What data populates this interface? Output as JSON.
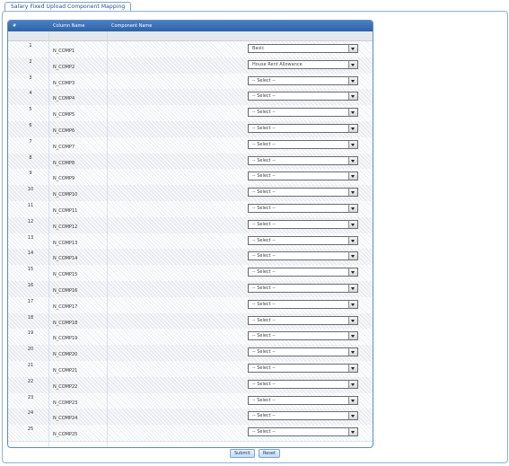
{
  "panel": {
    "title": "Salary Fixed Upload Component Mapping"
  },
  "table": {
    "headers": {
      "num": "#",
      "column": "Column Name",
      "component": "Component Name"
    },
    "rows": [
      {
        "num": "1",
        "column": "N_COMP1",
        "component": "Basic"
      },
      {
        "num": "2",
        "column": "N_COMP2",
        "component": "House Rent Allowance"
      },
      {
        "num": "3",
        "column": "N_COMP3",
        "component": "-- Select --"
      },
      {
        "num": "4",
        "column": "N_COMP4",
        "component": "-- Select --"
      },
      {
        "num": "5",
        "column": "N_COMP5",
        "component": "-- Select --"
      },
      {
        "num": "6",
        "column": "N_COMP6",
        "component": "-- Select --"
      },
      {
        "num": "7",
        "column": "N_COMP7",
        "component": "-- Select --"
      },
      {
        "num": "8",
        "column": "N_COMP8",
        "component": "-- Select --"
      },
      {
        "num": "9",
        "column": "N_COMP9",
        "component": "-- Select --"
      },
      {
        "num": "10",
        "column": "N_COMP10",
        "component": "-- Select --"
      },
      {
        "num": "11",
        "column": "N_COMP11",
        "component": "-- Select --"
      },
      {
        "num": "12",
        "column": "N_COMP12",
        "component": "-- Select --"
      },
      {
        "num": "13",
        "column": "N_COMP13",
        "component": "-- Select --"
      },
      {
        "num": "14",
        "column": "N_COMP14",
        "component": "-- Select --"
      },
      {
        "num": "15",
        "column": "N_COMP15",
        "component": "-- Select --"
      },
      {
        "num": "16",
        "column": "N_COMP16",
        "component": "-- Select --"
      },
      {
        "num": "17",
        "column": "N_COMP17",
        "component": "-- Select --"
      },
      {
        "num": "18",
        "column": "N_COMP18",
        "component": "-- Select --"
      },
      {
        "num": "19",
        "column": "N_COMP19",
        "component": "-- Select --"
      },
      {
        "num": "20",
        "column": "N_COMP20",
        "component": "-- Select --"
      },
      {
        "num": "21",
        "column": "N_COMP21",
        "component": "-- Select --"
      },
      {
        "num": "22",
        "column": "N_COMP22",
        "component": "-- Select --"
      },
      {
        "num": "23",
        "column": "N_COMP23",
        "component": "-- Select --"
      },
      {
        "num": "24",
        "column": "N_COMP24",
        "component": "-- Select --"
      },
      {
        "num": "25",
        "column": "N_COMP25",
        "component": "-- Select --"
      }
    ]
  },
  "buttons": {
    "submit": "Submit",
    "reset": "Reset"
  }
}
